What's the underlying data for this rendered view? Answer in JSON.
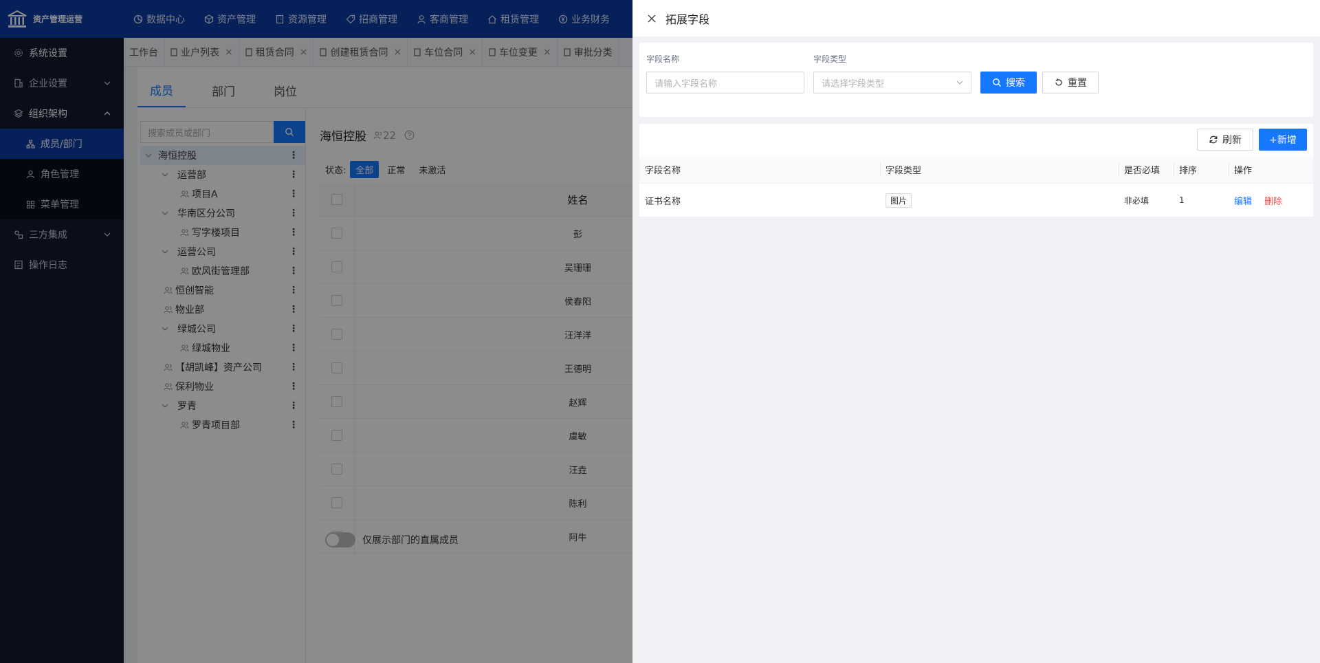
{
  "app": {
    "title": "资产管理运营"
  },
  "topnav": [
    "数据中心",
    "资产管理",
    "资源管理",
    "招商管理",
    "客商管理",
    "租赁管理",
    "业务财务"
  ],
  "sidebar": {
    "system": "系统设置",
    "enterprise": "企业设置",
    "org": "组织架构",
    "org_items": [
      "成员/部门",
      "角色管理",
      "菜单管理"
    ],
    "third_party": "三方集成",
    "oplog": "操作日志"
  },
  "tabs": [
    "工作台",
    "业户列表",
    "租赁合同",
    "创建租赁合同",
    "车位合同",
    "车位变更",
    "审批分类"
  ],
  "subtabs": [
    "成员",
    "部门",
    "岗位"
  ],
  "tree": {
    "search_placeholder": "搜索成员或部门",
    "nodes": [
      "海恒控股",
      "运营部",
      "项目A",
      "华南区分公司",
      "写字楼项目",
      "运营公司",
      "欧风街管理部",
      "恒创智能",
      "物业部",
      "绿城公司",
      "绿城物业",
      "【胡凯峰】资产公司",
      "保利物业",
      "罗青",
      "罗青项目部"
    ]
  },
  "members": {
    "title": "海恒控股",
    "count": "22",
    "status_label": "状态:",
    "statuses": [
      "全部",
      "正常",
      "未激活"
    ],
    "col_name": "姓名",
    "names": [
      "彭",
      "吴珊珊",
      "侯春阳",
      "汪洋洋",
      "王德明",
      "赵辉",
      "虞敏",
      "汪垚",
      "陈利",
      "阿牛"
    ],
    "toggle_label": "仅展示部门的直属成员"
  },
  "drawer": {
    "title": "拓展字段",
    "filter": {
      "name_label": "字段名称",
      "name_placeholder": "请输入字段名称",
      "type_label": "字段类型",
      "type_placeholder": "请选择字段类型",
      "search": "搜索",
      "reset": "重置"
    },
    "refresh": "刷新",
    "add": "+新增",
    "columns": [
      "字段名称",
      "字段类型",
      "是否必填",
      "排序",
      "操作"
    ],
    "rows": [
      {
        "name": "证书名称",
        "type": "图片",
        "required": "非必填",
        "sort": "1",
        "edit": "编辑",
        "delete": "删除"
      }
    ]
  },
  "colors": {
    "brand": "#0b3ba5",
    "primary": "#1677ff",
    "danger": "#ff4d4f",
    "sidebar_bg": "#121a2e"
  }
}
